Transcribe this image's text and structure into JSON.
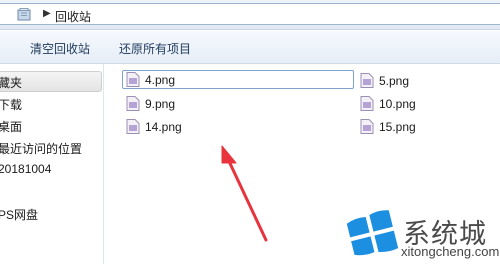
{
  "address": {
    "separator": "▶",
    "path": "回收站"
  },
  "toolbar": {
    "empty_label": "清空回收站",
    "restore_label": "还原所有项目"
  },
  "nav": {
    "items": [
      {
        "label": "藏夹"
      },
      {
        "label": "下载"
      },
      {
        "label": "桌面"
      },
      {
        "label": "最近访问的位置"
      },
      {
        "label": "20181004"
      },
      {
        "label": "PS网盘"
      }
    ]
  },
  "files": [
    {
      "name": "4.png",
      "selected": true
    },
    {
      "name": "5.png",
      "selected": false
    },
    {
      "name": "9.png",
      "selected": false
    },
    {
      "name": "10.png",
      "selected": false
    },
    {
      "name": "14.png",
      "selected": false
    },
    {
      "name": "15.png",
      "selected": false
    }
  ],
  "watermark": {
    "title": "系统城",
    "url": "xitongcheng.com"
  },
  "colors": {
    "accent": "#1e395b",
    "selection_border": "#7da2ce",
    "arrow": "#e8323c",
    "logo_blue": "#1d8fe0"
  }
}
